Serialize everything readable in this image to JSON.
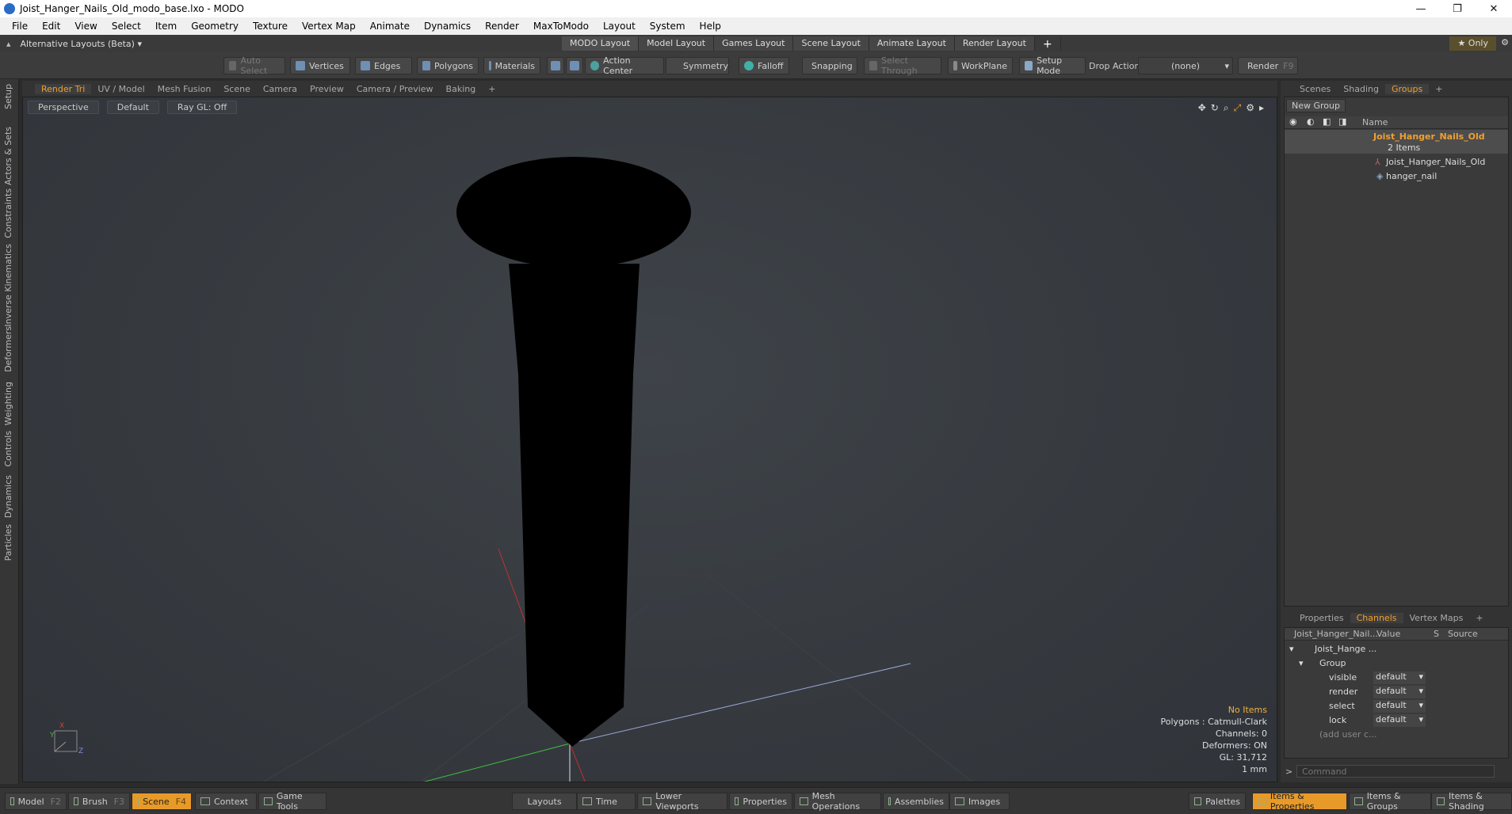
{
  "window": {
    "title": "Joist_Hanger_Nails_Old_modo_base.lxo - MODO",
    "controls": [
      "—",
      "❐",
      "✕"
    ]
  },
  "menu": [
    "File",
    "Edit",
    "View",
    "Select",
    "Item",
    "Geometry",
    "Texture",
    "Vertex Map",
    "Animate",
    "Dynamics",
    "Render",
    "MaxToModo",
    "Layout",
    "System",
    "Help"
  ],
  "layoutbar": {
    "alt_layouts": "Alternative Layouts (Beta) ▾",
    "tabs": [
      "MODO Layout",
      "Model Layout",
      "Games Layout",
      "Scene Layout",
      "Animate Layout",
      "Render Layout"
    ],
    "add": "+",
    "only": "★ Only"
  },
  "toolbar": {
    "auto_select": "Auto Select",
    "vertices": "Vertices",
    "edges": "Edges",
    "polygons": "Polygons",
    "materials": "Materials",
    "action_center": "Action Center",
    "symmetry": "Symmetry",
    "falloff": "Falloff",
    "snapping": "Snapping",
    "select_through": "Select Through",
    "workplane": "WorkPlane",
    "setup_mode": "Setup Mode",
    "drop_action": "Drop Action",
    "drop_value": "(none)",
    "render": "Render",
    "render_key": "F9"
  },
  "left_tabs": [
    "Setup",
    "Actors & Sets",
    "Constraints",
    "Inverse Kinematics",
    "Deformers",
    "Weighting",
    "Controls",
    "Dynamics",
    "Particles"
  ],
  "viewport_tabs": [
    "Render Tri",
    "UV / Model",
    "Mesh Fusion",
    "Scene",
    "Camera",
    "Preview",
    "Camera / Preview",
    "Baking",
    "+"
  ],
  "viewport": {
    "view": "Perspective",
    "shading": "Default",
    "raygl": "Ray GL: Off",
    "info": {
      "items": "No Items",
      "polygons": "Polygons : Catmull-Clark",
      "channels": "Channels: 0",
      "deformers": "Deformers: ON",
      "gl": "GL: 31,712",
      "unit": "1 mm"
    }
  },
  "right_tabs_top": [
    "Scenes",
    "Shading",
    "Groups",
    "+"
  ],
  "groups": {
    "new_group": "New Group",
    "name_header": "Name",
    "group_name": "Joist_Hanger_Nails_Old",
    "group_count": "2 Items",
    "children": [
      "Joist_Hanger_Nails_Old",
      "hanger_nail"
    ]
  },
  "right_tabs_bottom": [
    "Properties",
    "Channels",
    "Vertex Maps",
    "+"
  ],
  "channels": {
    "headers": {
      "name": "Joist_Hanger_Nail...",
      "value": "Value",
      "s": "S",
      "source": "Source"
    },
    "item": "Joist_Hange ...",
    "group": "Group",
    "rows": [
      {
        "label": "visible",
        "value": "default"
      },
      {
        "label": "render",
        "value": "default"
      },
      {
        "label": "select",
        "value": "default"
      },
      {
        "label": "lock",
        "value": "default"
      }
    ],
    "add_user": "(add user c..."
  },
  "command": {
    "placeholder": "Command",
    "prompt": ">"
  },
  "bottom": {
    "model": "Model",
    "model_key": "F2",
    "brush": "Brush",
    "brush_key": "F3",
    "scene": "Scene",
    "scene_key": "F4",
    "context": "Context",
    "game_tools": "Game Tools",
    "layouts": "Layouts",
    "time": "Time",
    "lower_viewports": "Lower Viewports",
    "properties": "Properties",
    "mesh_operations": "Mesh Operations",
    "assemblies": "Assemblies",
    "images": "Images",
    "palettes": "Palettes",
    "items_properties": "Items & Properties",
    "items_groups": "Items & Groups",
    "items_shading": "Items & Shading"
  },
  "colors": {
    "accent": "#f0a030",
    "viewport_bg": "#383c41",
    "nail": "#000000"
  }
}
